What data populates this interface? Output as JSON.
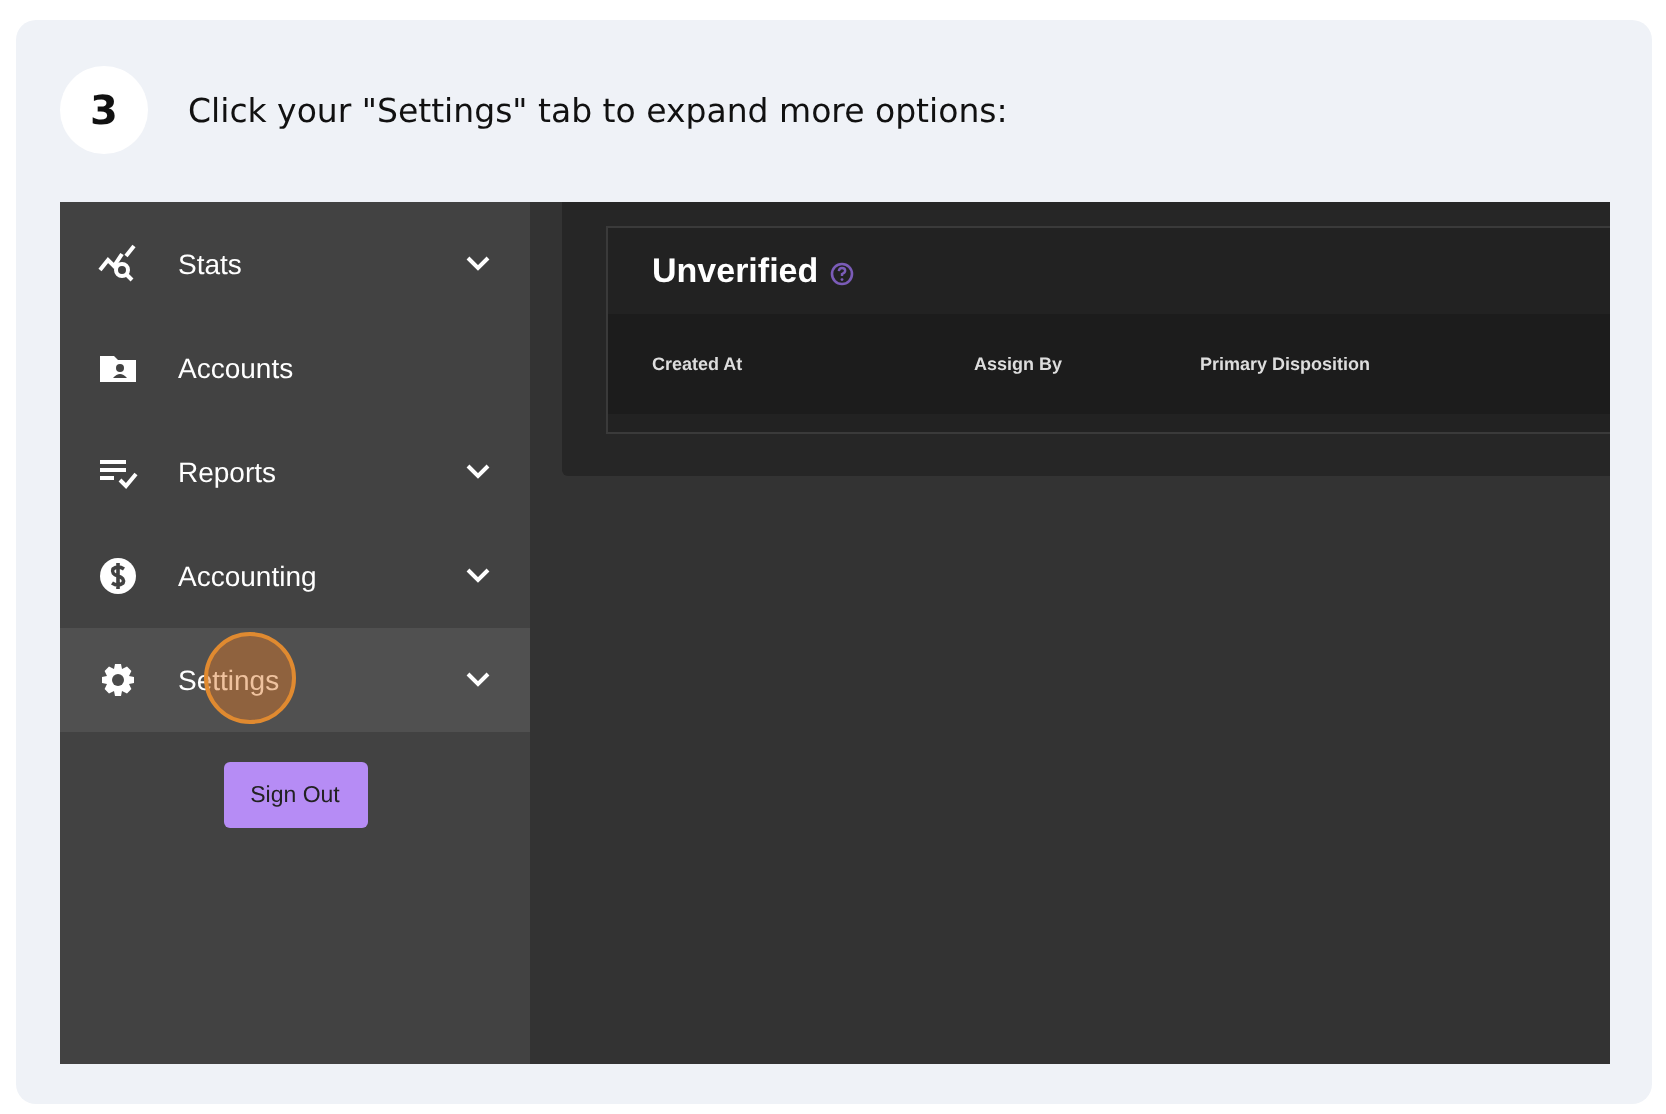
{
  "step": {
    "number": "3",
    "instruction": "Click your \"Settings\" tab to expand more options:"
  },
  "sidebar": {
    "items": [
      {
        "label": "Stats",
        "expandable": true,
        "selected": false,
        "clicked": false
      },
      {
        "label": "Accounts",
        "expandable": false,
        "selected": false,
        "clicked": false
      },
      {
        "label": "Reports",
        "expandable": true,
        "selected": false,
        "clicked": false
      },
      {
        "label": "Accounting",
        "expandable": true,
        "selected": false,
        "clicked": false
      },
      {
        "label": "Settings",
        "expandable": true,
        "selected": true,
        "clicked": true
      }
    ],
    "sign_out": "Sign Out"
  },
  "panel": {
    "title": "Unverified",
    "columns": [
      "Created At",
      "Assign By",
      "Primary Disposition"
    ]
  }
}
